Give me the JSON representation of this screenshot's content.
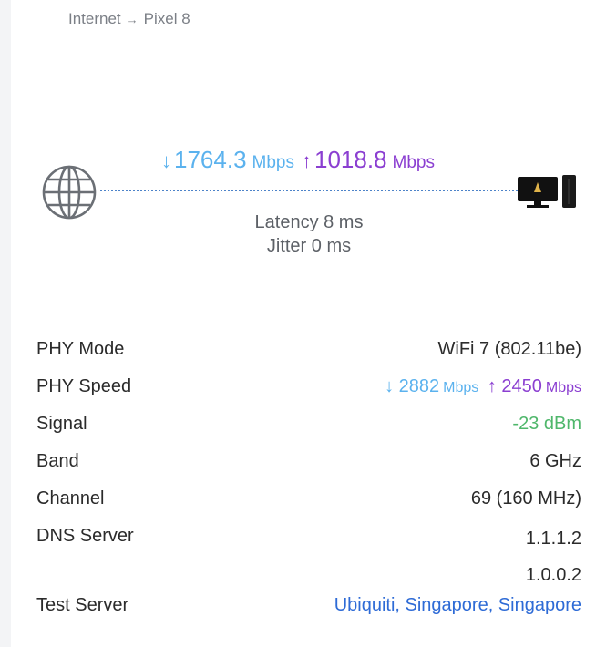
{
  "breadcrumb": {
    "from": "Internet",
    "to": "Pixel 8"
  },
  "speed": {
    "down_arrow": "↓",
    "down_value": "1764.3",
    "up_arrow": "↑",
    "up_value": "1018.8",
    "unit": "Mbps",
    "colors": {
      "down": "#5bb2ee",
      "up": "#8b3fd1"
    }
  },
  "latency": {
    "latency_text": "Latency 8 ms",
    "jitter_text": "Jitter 0 ms"
  },
  "icons": {
    "internet": "globe-icon",
    "device": "desktop-computer-icon"
  },
  "details": {
    "phy_mode": {
      "label": "PHY Mode",
      "value": "WiFi 7 (802.11be)"
    },
    "phy_speed": {
      "label": "PHY Speed",
      "down_value": "2882",
      "up_value": "2450",
      "unit": "Mbps"
    },
    "signal": {
      "label": "Signal",
      "value": "-23 dBm",
      "color": "#4fb76b"
    },
    "band": {
      "label": "Band",
      "value": "6 GHz"
    },
    "channel": {
      "label": "Channel",
      "value": "69 (160 MHz)"
    },
    "dns_server": {
      "label": "DNS Server",
      "values": [
        "1.1.1.2",
        "1.0.0.2"
      ]
    },
    "test_server": {
      "label": "Test Server",
      "value": "Ubiquiti, Singapore, Singapore"
    }
  }
}
